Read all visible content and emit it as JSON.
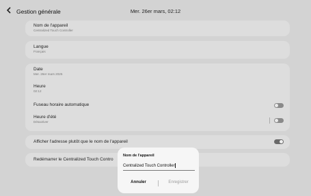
{
  "header": {
    "title": "Gestion générale",
    "datetime": "Mer. 26er mars, 02:12"
  },
  "settings": {
    "device_name": {
      "label": "Nom de l'appareil",
      "value": "Centralized Touch Controller"
    },
    "language": {
      "label": "Langue",
      "value": "Français"
    },
    "date": {
      "label": "Date",
      "value": "Mer. 26er mars 2025"
    },
    "time": {
      "label": "Heure",
      "value": "02:12"
    },
    "auto_timezone": {
      "label": "Fuseau horaire automatique",
      "enabled": false
    },
    "dst": {
      "label": "Heure d'été",
      "value": "Désactiver",
      "enabled": false
    },
    "show_address": {
      "label": "Afficher l'adresse plutôt que le nom de l'appareil",
      "enabled": true
    },
    "restart": {
      "label": "Redémarrer le Centralized Touch Contro"
    }
  },
  "dialog": {
    "title": "Nom de l'appareil",
    "input_value": "Centralized Touch Controller",
    "cancel_label": "Annuler",
    "save_label": "Enregistrer"
  },
  "colors": {
    "background": "#d3d3d3",
    "card": "#dddddd",
    "dialog": "#f6f6f6",
    "disabled_text": "#9a9a9a"
  }
}
